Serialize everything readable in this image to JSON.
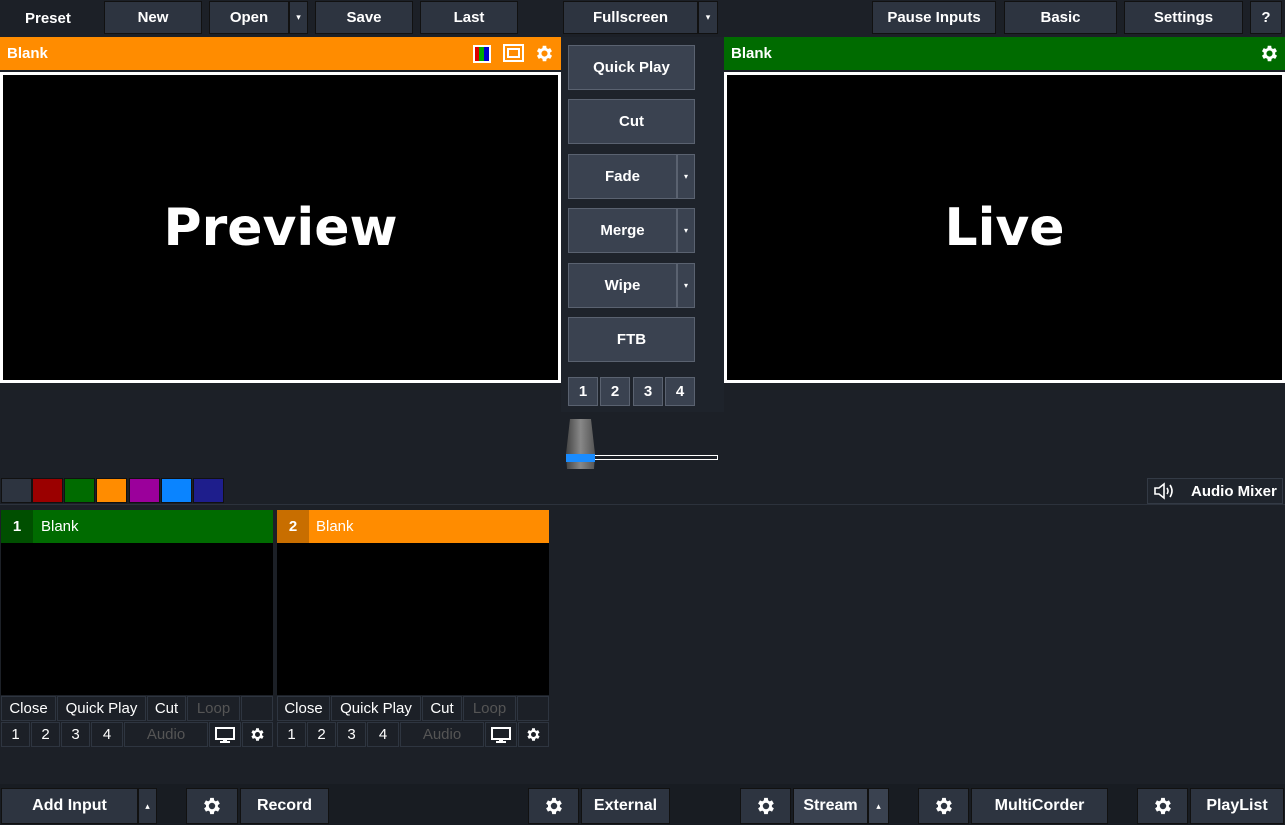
{
  "toolbar": {
    "preset_label": "Preset",
    "new_label": "New",
    "open_label": "Open",
    "save_label": "Save",
    "last_label": "Last",
    "fullscreen_label": "Fullscreen",
    "pause_inputs_label": "Pause Inputs",
    "basic_label": "Basic",
    "settings_label": "Settings",
    "help_label": "?"
  },
  "preview": {
    "header_title": "Blank",
    "header_color": "#ff8c00",
    "screen_label": "Preview"
  },
  "live": {
    "header_title": "Blank",
    "header_color": "#006b00",
    "screen_label": "Live"
  },
  "transitions": {
    "quick_play": "Quick Play",
    "cut": "Cut",
    "fade": "Fade",
    "merge": "Merge",
    "wipe": "Wipe",
    "ftb": "FTB",
    "numbers": [
      "1",
      "2",
      "3",
      "4"
    ],
    "tbar_value": 0
  },
  "color_filters": [
    "#2d3440",
    "#9b0000",
    "#006b00",
    "#ff8c00",
    "#9b009b",
    "#0a84ff",
    "#1e1e8c"
  ],
  "audio_mixer_label": "Audio Mixer",
  "inputs": [
    {
      "number": "1",
      "title": "Blank",
      "color": "#006b00",
      "num_bg": "#004f00",
      "close": "Close",
      "quick_play": "Quick Play",
      "cut": "Cut",
      "loop": "Loop",
      "overlays": [
        "1",
        "2",
        "3",
        "4"
      ],
      "audio": "Audio"
    },
    {
      "number": "2",
      "title": "Blank",
      "color": "#ff8c00",
      "num_bg": "#c86e00",
      "close": "Close",
      "quick_play": "Quick Play",
      "cut": "Cut",
      "loop": "Loop",
      "overlays": [
        "1",
        "2",
        "3",
        "4"
      ],
      "audio": "Audio"
    }
  ],
  "bottom": {
    "add_input": "Add Input",
    "record": "Record",
    "external": "External",
    "stream": "Stream",
    "multicorder": "MultiCorder",
    "playlist": "PlayList"
  }
}
